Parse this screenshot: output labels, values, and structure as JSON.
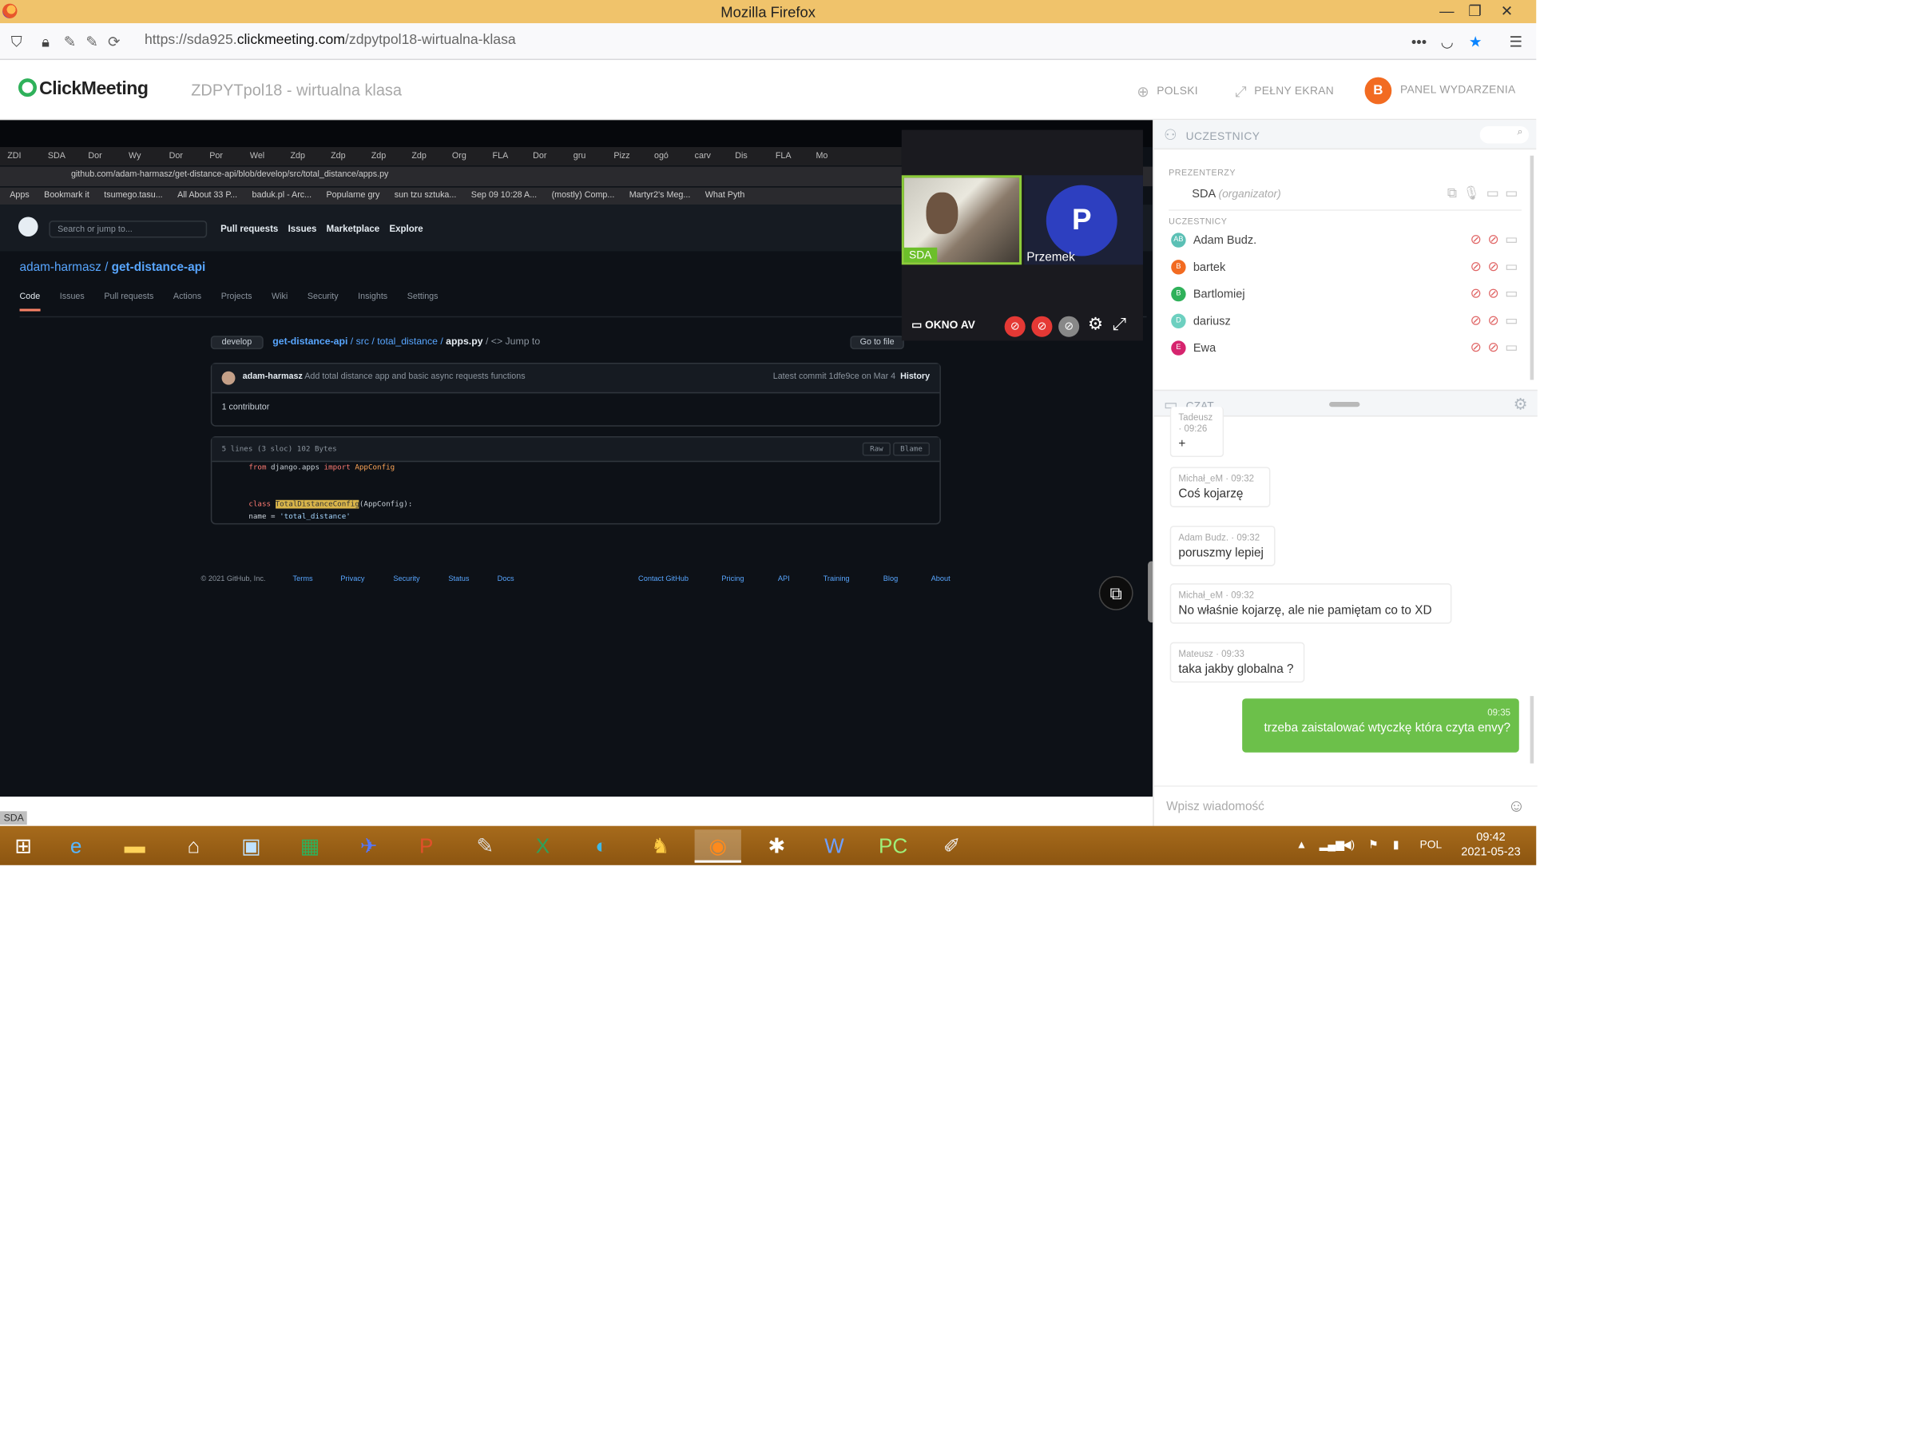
{
  "browser": {
    "window_title": "Mozilla Firefox",
    "url_prefix": "https://sda925.",
    "url_domain": "clickmeeting.com",
    "url_path": "/zdpytpol18-wirtualna-klasa"
  },
  "header": {
    "logo": "ClickMeeting",
    "room_title": "ZDPYTpol18 - wirtualna klasa",
    "language": "POLSKI",
    "fullscreen": "PEŁNY EKRAN",
    "event_panel": "PANEL WYDARZENIA",
    "user_initial": "B"
  },
  "shared_screen": {
    "tabs": [
      "ZDI",
      "SDA",
      "Dor",
      "Wy",
      "Dor",
      "Por",
      "Wel",
      "Zdp",
      "Zdp",
      "Zdp",
      "Zdp",
      "Org",
      "FLA",
      "Dor",
      "gru",
      "Pizz",
      "ogó",
      "carv",
      "Dis",
      "FLA",
      "Mo"
    ],
    "address": "github.com/adam-harmasz/get-distance-api/blob/develop/src/total_distance/apps.py",
    "bookmarks": [
      "Apps",
      "Bookmark it",
      "tsumego.tasu...",
      "All About 33 P...",
      "baduk.pl - Arc...",
      "Popularne gry",
      "sun tzu sztuka...",
      "Sep 09 10:28 A...",
      "(mostly) Comp...",
      "Martyr2's Meg...",
      "What Pyth"
    ],
    "search_placeholder": "Search or jump to...",
    "nav_links": [
      "Pull requests",
      "Issues",
      "Marketplace",
      "Explore"
    ],
    "repo_owner": "adam-harmasz",
    "repo_name": "get-distance-api",
    "repo_tabs": [
      "Code",
      "Issues",
      "Pull requests",
      "Actions",
      "Projects",
      "Wiki",
      "Security",
      "Insights",
      "Settings"
    ],
    "branch": "develop",
    "path_root": "get-distance-api",
    "path_mid": "/ src / total_distance /",
    "path_file": "apps.py",
    "jump": "/ <> Jump to",
    "go_to_file": "Go to file",
    "commit_author": "adam-harmasz",
    "commit_msg": "Add total distance app and basic async requests functions",
    "commit_latest": "Latest commit 1dfe9ce on Mar 4",
    "history": "History",
    "contributors": "1 contributor",
    "file_info": "5 lines (3 sloc)   102 Bytes",
    "raw": "Raw",
    "blame": "Blame",
    "code_lines": {
      "l1_kw": "from",
      "l1_rest": " django.apps ",
      "l1_kw2": "import",
      "l1_end": " AppConfig",
      "l4_kw": "class",
      "l4_hl": "TotalDistanceConfig",
      "l4_end": "(AppConfig):",
      "l5_a": "    name = ",
      "l5_str": "'total_distance'"
    },
    "footer": [
      "© 2021 GitHub, Inc.",
      "Terms",
      "Privacy",
      "Security",
      "Status",
      "Docs",
      "Contact GitHub",
      "Pricing",
      "API",
      "Training",
      "Blog",
      "About"
    ],
    "presenter_tag": "SDA"
  },
  "av_window": {
    "label": "OKNO AV",
    "cam1_name": "SDA",
    "cam2_name": "Przemek",
    "cam2_initial": "P"
  },
  "participants": {
    "header": "UCZESTNICY",
    "presenters_label": "PREZENTERZY",
    "presenter_name": "SDA",
    "presenter_role": "(organizator)",
    "attendees_label": "UCZESTNICY",
    "list": [
      {
        "initials": "AB",
        "name": "Adam Budz.",
        "color": "#5bc0b5"
      },
      {
        "initials": "B",
        "name": "bartek",
        "color": "#f26b21"
      },
      {
        "initials": "B",
        "name": "Bartlomiej",
        "color": "#2fb15a"
      },
      {
        "initials": "D",
        "name": "dariusz",
        "color": "#6dd0c0"
      },
      {
        "initials": "E",
        "name": "Ewa",
        "color": "#d6246e"
      }
    ]
  },
  "chat": {
    "header": "CZAT",
    "messages": [
      {
        "author": "Tadeusz",
        "time": "09:26",
        "text": "+"
      },
      {
        "author": "Michał_eM",
        "time": "09:32",
        "text": "Coś kojarzę"
      },
      {
        "author": "Adam Budz.",
        "time": "09:32",
        "text": "poruszmy lepiej"
      },
      {
        "author": "Michał_eM",
        "time": "09:32",
        "text": "No właśnie kojarzę, ale nie pamiętam co to XD"
      },
      {
        "author": "Mateusz",
        "time": "09:33",
        "text": "taka jakby globalna ?"
      },
      {
        "author": "",
        "time": "09:35",
        "text": "trzeba zaistalować wtyczkę która czyta envy?"
      }
    ],
    "input_placeholder": "Wpisz wiadomość"
  },
  "taskbar": {
    "language": "POL",
    "time": "09:42",
    "date": "2021-05-23"
  },
  "colors": {
    "titlebar": "#f0c36b",
    "brand_green": "#2fb15a",
    "my_message": "#6cc04a",
    "taskbar": "#a76b1c"
  }
}
